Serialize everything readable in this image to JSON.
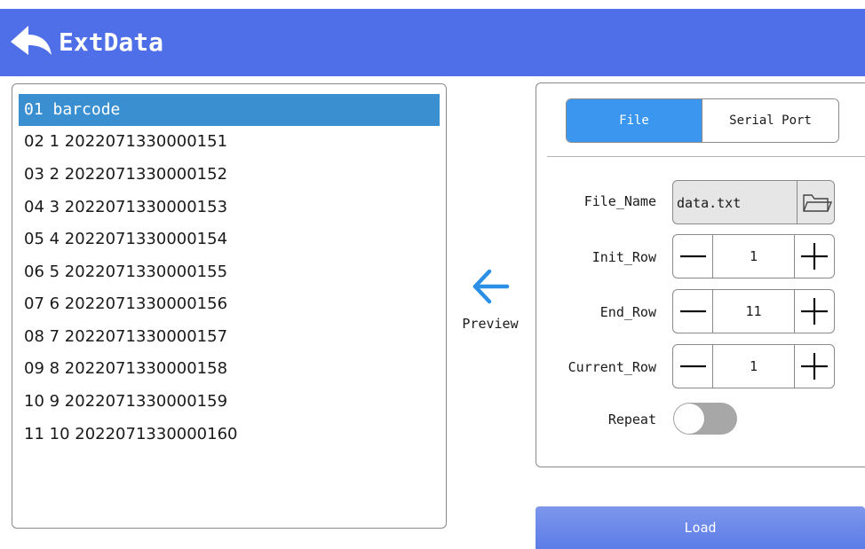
{
  "header": {
    "title": "ExtData"
  },
  "list": {
    "items": [
      "01 barcode",
      "02 1 2022071330000151",
      "03 2 2022071330000152",
      "04 3 2022071330000153",
      "05 4 2022071330000154",
      "06 5 2022071330000155",
      "07 6 2022071330000156",
      "08 7 2022071330000157",
      "09 8 2022071330000158",
      "10 9 2022071330000159",
      "11 10 2022071330000160"
    ],
    "selected_index": 0
  },
  "preview": {
    "label": "Preview",
    "icon": "arrow-left-icon"
  },
  "tabs": {
    "file": "File",
    "serial": "Serial Port",
    "active": "File"
  },
  "fields": {
    "file_name_label": "File_Name",
    "file_name_value": "data.txt",
    "init_row_label": "Init_Row",
    "init_row_value": "1",
    "end_row_label": "End_Row",
    "end_row_value": "11",
    "current_row_label": "Current_Row",
    "current_row_value": "1",
    "repeat_label": "Repeat",
    "repeat_on": false
  },
  "load": {
    "label": "Load"
  },
  "colors": {
    "header": "#4f6fe8",
    "accent": "#3a96ee",
    "selection": "#3a8fd0"
  }
}
